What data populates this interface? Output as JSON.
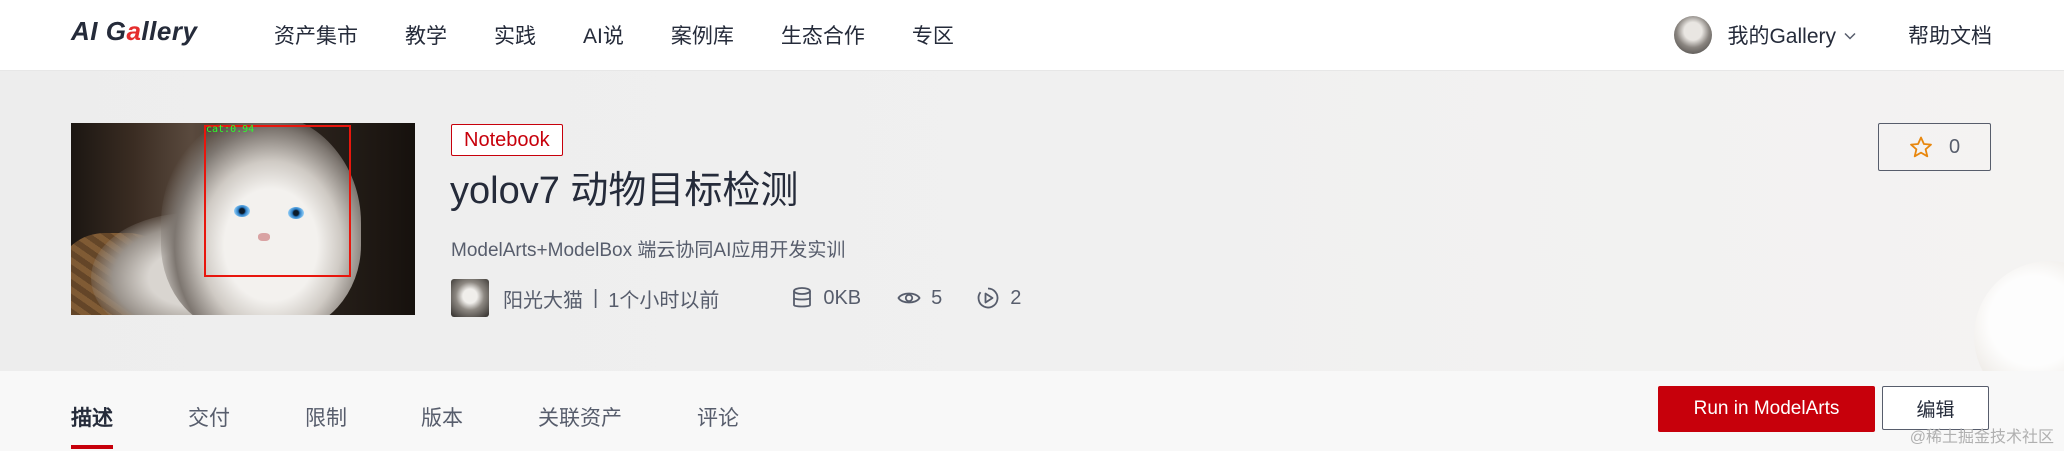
{
  "nav": {
    "logo_prefix": "AI G",
    "logo_dot": "a",
    "logo_suffix": "llery",
    "links": [
      "资产集市",
      "教学",
      "实践",
      "AI说",
      "案例库",
      "生态合作",
      "专区"
    ],
    "my_gallery": "我的Gallery",
    "help_docs": "帮助文档"
  },
  "asset": {
    "tag": "Notebook",
    "title": "yolov7 动物目标检测",
    "subtitle": "ModelArts+ModelBox 端云协同AI应用开发实训",
    "cover_detection_label": "cat:0.94",
    "author": "阳光大猫",
    "separator": "|",
    "time": "1个小时以前",
    "size": "0KB",
    "views": "5",
    "runs": "2",
    "favorites": "0"
  },
  "tabs": {
    "items": [
      "描述",
      "交付",
      "限制",
      "版本",
      "关联资产",
      "评论"
    ],
    "active_index": 0
  },
  "actions": {
    "run_label": "Run in ModelArts",
    "edit_label": "编辑"
  },
  "watermark": "@稀土掘金技术社区",
  "colors": {
    "brand_red": "#c7000b",
    "text_primary": "#252b3a",
    "text_secondary": "#575d6c"
  },
  "icons": {
    "size": "database-icon",
    "views": "eye-icon",
    "runs": "play-circle-icon",
    "favorite": "star-icon",
    "dropdown": "chevron-down-icon"
  }
}
